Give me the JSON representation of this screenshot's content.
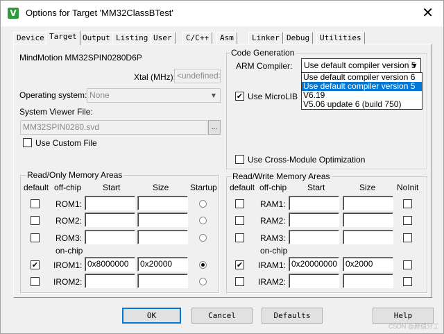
{
  "window": {
    "title": "Options for Target 'MM32ClassBTest'"
  },
  "tabs": [
    {
      "label": "Device",
      "active": false
    },
    {
      "label": "Target",
      "active": true
    },
    {
      "label": "Output",
      "active": false
    },
    {
      "label": "Listing",
      "active": false
    },
    {
      "label": "User",
      "active": false
    },
    {
      "label": "C/C++",
      "active": false
    },
    {
      "label": "Asm",
      "active": false
    },
    {
      "label": "Linker",
      "active": false
    },
    {
      "label": "Debug",
      "active": false
    },
    {
      "label": "Utilities",
      "active": false
    }
  ],
  "device": {
    "name": "MindMotion MM32SPIN0280D6P",
    "xtal_label": "Xtal (MHz):",
    "xtal_value": "<undefined>",
    "os_label": "Operating system:",
    "os_value": "None",
    "svd_label": "System Viewer File:",
    "svd_value": "MM32SPIN0280.svd",
    "browse_label": "...",
    "custom_file_label": "Use Custom File"
  },
  "code_generation": {
    "title": "Code Generation",
    "arm_compiler_label": "ARM Compiler:",
    "arm_compiler_value": "Use default compiler version 5",
    "options": [
      "Use default compiler version 6",
      "Use default compiler version 5",
      "V6.19",
      "V5.06 update 6 (build 750)"
    ],
    "microlib_label": "Use MicroLIB",
    "cross_module_label": "Use Cross-Module Optimization"
  },
  "rom_areas": {
    "title": "Read/Only Memory Areas",
    "headers": {
      "default": "default",
      "offchip": "off-chip",
      "start": "Start",
      "size": "Size",
      "startup": "Startup"
    },
    "onchip_label": "on-chip",
    "rows": [
      {
        "name": "ROM1:",
        "start": "",
        "size": "",
        "checked": false,
        "startup": false
      },
      {
        "name": "ROM2:",
        "start": "",
        "size": "",
        "checked": false,
        "startup": false
      },
      {
        "name": "ROM3:",
        "start": "",
        "size": "",
        "checked": false,
        "startup": false
      },
      {
        "name": "IROM1:",
        "start": "0x8000000",
        "size": "0x20000",
        "checked": true,
        "startup": true
      },
      {
        "name": "IROM2:",
        "start": "",
        "size": "",
        "checked": false,
        "startup": false
      }
    ]
  },
  "ram_areas": {
    "title": "Read/Write Memory Areas",
    "headers": {
      "default": "default",
      "offchip": "off-chip",
      "start": "Start",
      "size": "Size",
      "noinit": "NoInit"
    },
    "onchip_label": "on-chip",
    "rows": [
      {
        "name": "RAM1:",
        "start": "",
        "size": "",
        "checked": false
      },
      {
        "name": "RAM2:",
        "start": "",
        "size": "",
        "checked": false
      },
      {
        "name": "RAM3:",
        "start": "",
        "size": "",
        "checked": false
      },
      {
        "name": "IRAM1:",
        "start": "0x20000000",
        "size": "0x2000",
        "checked": true
      },
      {
        "name": "IRAM2:",
        "start": "",
        "size": "",
        "checked": false
      }
    ]
  },
  "buttons": {
    "ok": "OK",
    "cancel": "Cancel",
    "defaults": "Defaults",
    "help": "Help"
  },
  "watermark": "CSDN @颜值分工"
}
